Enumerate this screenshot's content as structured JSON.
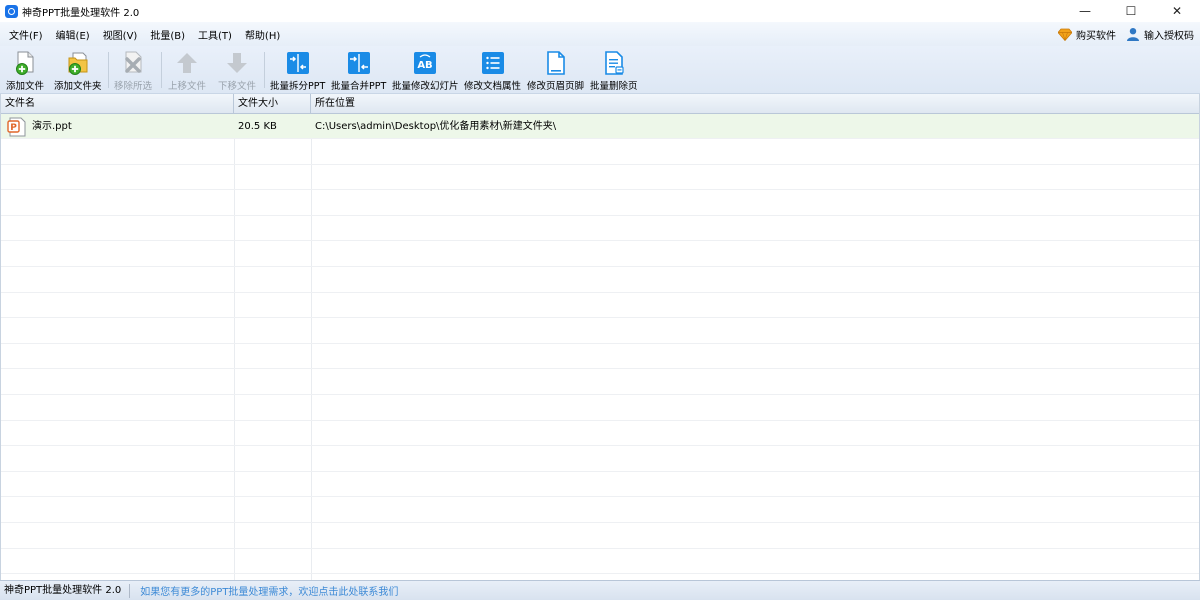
{
  "window": {
    "title": "神奇PPT批量处理软件 2.0",
    "minimize": "—",
    "maximize": "☐",
    "close": "✕"
  },
  "menu": {
    "items": [
      "文件(F)",
      "编辑(E)",
      "视图(V)",
      "批量(B)",
      "工具(T)",
      "帮助(H)"
    ],
    "buy": "购买软件",
    "license": "输入授权码"
  },
  "toolbar": {
    "items": [
      {
        "label": "添加文件",
        "icon": "add-file-icon",
        "enabled": true
      },
      {
        "label": "添加文件夹",
        "icon": "add-folder-icon",
        "enabled": true
      },
      {
        "label": "移除所选",
        "icon": "remove-icon",
        "enabled": false
      },
      {
        "label": "上移文件",
        "icon": "arrow-up-icon",
        "enabled": false
      },
      {
        "label": "下移文件",
        "icon": "arrow-down-icon",
        "enabled": false
      },
      {
        "label": "批量拆分PPT",
        "icon": "split-icon",
        "enabled": true
      },
      {
        "label": "批量合并PPT",
        "icon": "merge-icon",
        "enabled": true
      },
      {
        "label": "批量修改幻灯片",
        "icon": "ab-icon",
        "enabled": true
      },
      {
        "label": "修改文档属性",
        "icon": "list-icon",
        "enabled": true
      },
      {
        "label": "修改页眉页脚",
        "icon": "page-icon",
        "enabled": true
      },
      {
        "label": "批量删除页",
        "icon": "delete-page-icon",
        "enabled": true
      }
    ]
  },
  "table": {
    "columns": [
      "文件名",
      "文件大小",
      "所在位置"
    ],
    "rows": [
      {
        "name": "演示.ppt",
        "size": "20.5 KB",
        "path": "C:\\Users\\admin\\Desktop\\优化备用素材\\新建文件夹\\"
      }
    ]
  },
  "status": {
    "app_name": "神奇PPT批量处理软件 2.0",
    "message": "如果您有更多的PPT批量处理需求，欢迎点击此处联系我们"
  },
  "colors": {
    "accent_blue": "#1a8be6",
    "status_link": "#3d8ad6",
    "selected_row": "#edf7e9"
  }
}
